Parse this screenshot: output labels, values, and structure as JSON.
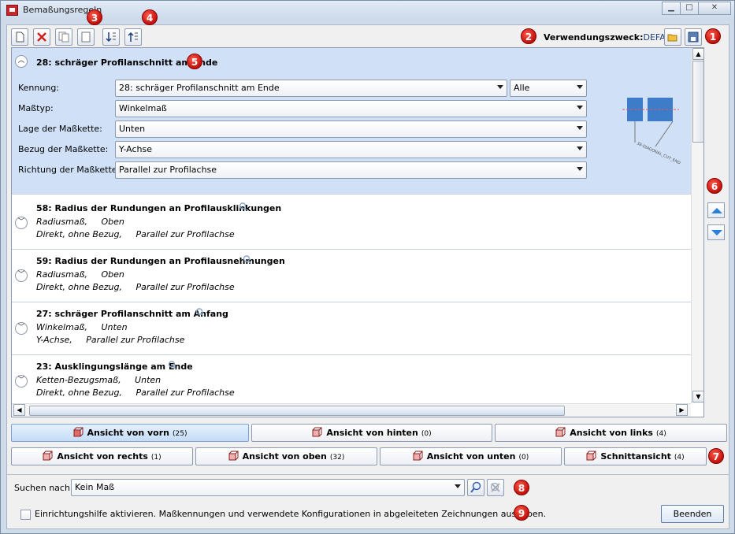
{
  "window": {
    "title": "Bemaßungsregeln"
  },
  "toolbar": {
    "purpose_label": "Verwendungszweck:",
    "purpose_value": "DEFAULT"
  },
  "badges": [
    "1",
    "2",
    "3",
    "4",
    "5",
    "6",
    "7",
    "8",
    "9"
  ],
  "selected_rule": {
    "title": "28: schräger Profilanschnitt am Ende",
    "fields": [
      {
        "label": "Kennung:",
        "value": "28: schräger Profilanschnitt am Ende",
        "extra": "Alle"
      },
      {
        "label": "Maßtyp:",
        "value": "Winkelmaß"
      },
      {
        "label": "Lage der Maßkette:",
        "value": "Unten"
      },
      {
        "label": "Bezug der Maßkette:",
        "value": "Y-Achse"
      },
      {
        "label": "Richtung der Maßkette:",
        "value": "Parallel zur Profilachse"
      }
    ],
    "preview_text": "38-DIAGONAL_CUT_END"
  },
  "rules": [
    {
      "title": "58: Radius der Rundungen an Profilausklinkungen",
      "line1": "Radiusmaß,     Oben",
      "line2": "Direkt, ohne Bezug,     Parallel zur Profilachse"
    },
    {
      "title": "59: Radius der Rundungen an Profilausnehmungen",
      "line1": "Radiusmaß,     Oben",
      "line2": "Direkt, ohne Bezug,     Parallel zur Profilachse"
    },
    {
      "title": "27: schräger Profilanschnitt am Anfang",
      "line1": "Winkelmaß,     Unten",
      "line2": "Y-Achse,     Parallel zur Profilachse"
    },
    {
      "title": "23: Ausklingungslänge am Ende",
      "line1": "Ketten-Bezugsmaß,     Unten",
      "line2": "Direkt, ohne Bezug,     Parallel zur Profilachse"
    }
  ],
  "views_row1": [
    {
      "label": "Ansicht von vorn",
      "count": "(25)"
    },
    {
      "label": "Ansicht von hinten",
      "count": "(0)"
    },
    {
      "label": "Ansicht von links",
      "count": "(4)"
    }
  ],
  "views_row2": [
    {
      "label": "Ansicht von rechts",
      "count": "(1)"
    },
    {
      "label": "Ansicht von oben",
      "count": "(32)"
    },
    {
      "label": "Ansicht von unten",
      "count": "(0)"
    },
    {
      "label": "Schnittansicht",
      "count": "(4)"
    }
  ],
  "search": {
    "label": "Suchen nach:",
    "value": "Kein Maß"
  },
  "checkbox": {
    "label": "Einrichtungshilfe aktivieren. Maßkennungen und verwendete Konfigurationen in abgeleiteten Zeichnungen ausgeben."
  },
  "buttons": {
    "end": "Beenden"
  }
}
